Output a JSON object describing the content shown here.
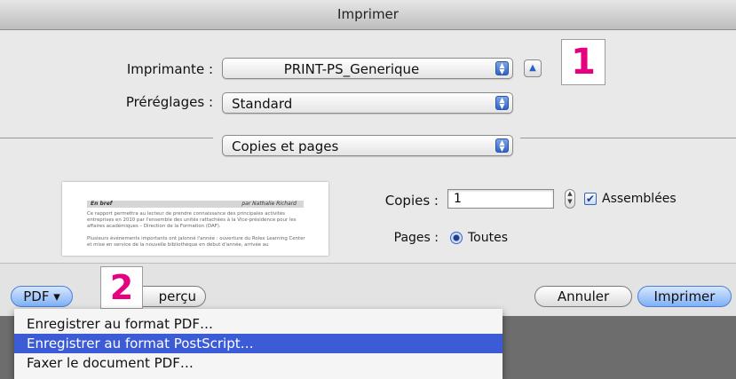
{
  "window": {
    "title": "Imprimer"
  },
  "printer": {
    "label": "Imprimante :",
    "value": "PRINT-PS_Generique"
  },
  "presets": {
    "label": "Préréglages :",
    "value": "Standard"
  },
  "section": {
    "value": "Copies et pages"
  },
  "callouts": {
    "one": "1",
    "two": "2"
  },
  "copies": {
    "label": "Copies :",
    "value": "1",
    "collated_label": "Assemblées",
    "collated": true
  },
  "pages": {
    "label": "Pages :",
    "all_label": "Toutes"
  },
  "preview": {
    "header_left": "En bref",
    "header_right": "par Nathalie Richard",
    "para1": "Ce rapport permettra au lecteur de prendre connaissance des principales activités entreprises en 2010 par l'ensemble des unités rattachées à la Vice-présidence pour les affaires académiques – Direction de la Formation (DAF).",
    "para2": "Plusieurs événements importants ont jalonné l'année : ouverture du Rolex Learning Center et mise en service de la nouvelle bibliothèque en début d'année, arrivée au"
  },
  "buttons": {
    "pdf": "PDF ▾",
    "preview": "perçu",
    "cancel": "Annuler",
    "print": "Imprimer"
  },
  "pdf_menu": {
    "items": [
      "Enregistrer au format PDF…",
      "Enregistrer au format PostScript…",
      "Faxer le document PDF…"
    ],
    "selected_index": 1
  },
  "icons": {
    "disclosure": "disclosure-triangle-icon",
    "popup_arrows": "popup-arrows-icon",
    "checkmark": "checkmark-icon"
  },
  "colors": {
    "accent": "#3b5cd6",
    "callout": "#e4007f"
  }
}
